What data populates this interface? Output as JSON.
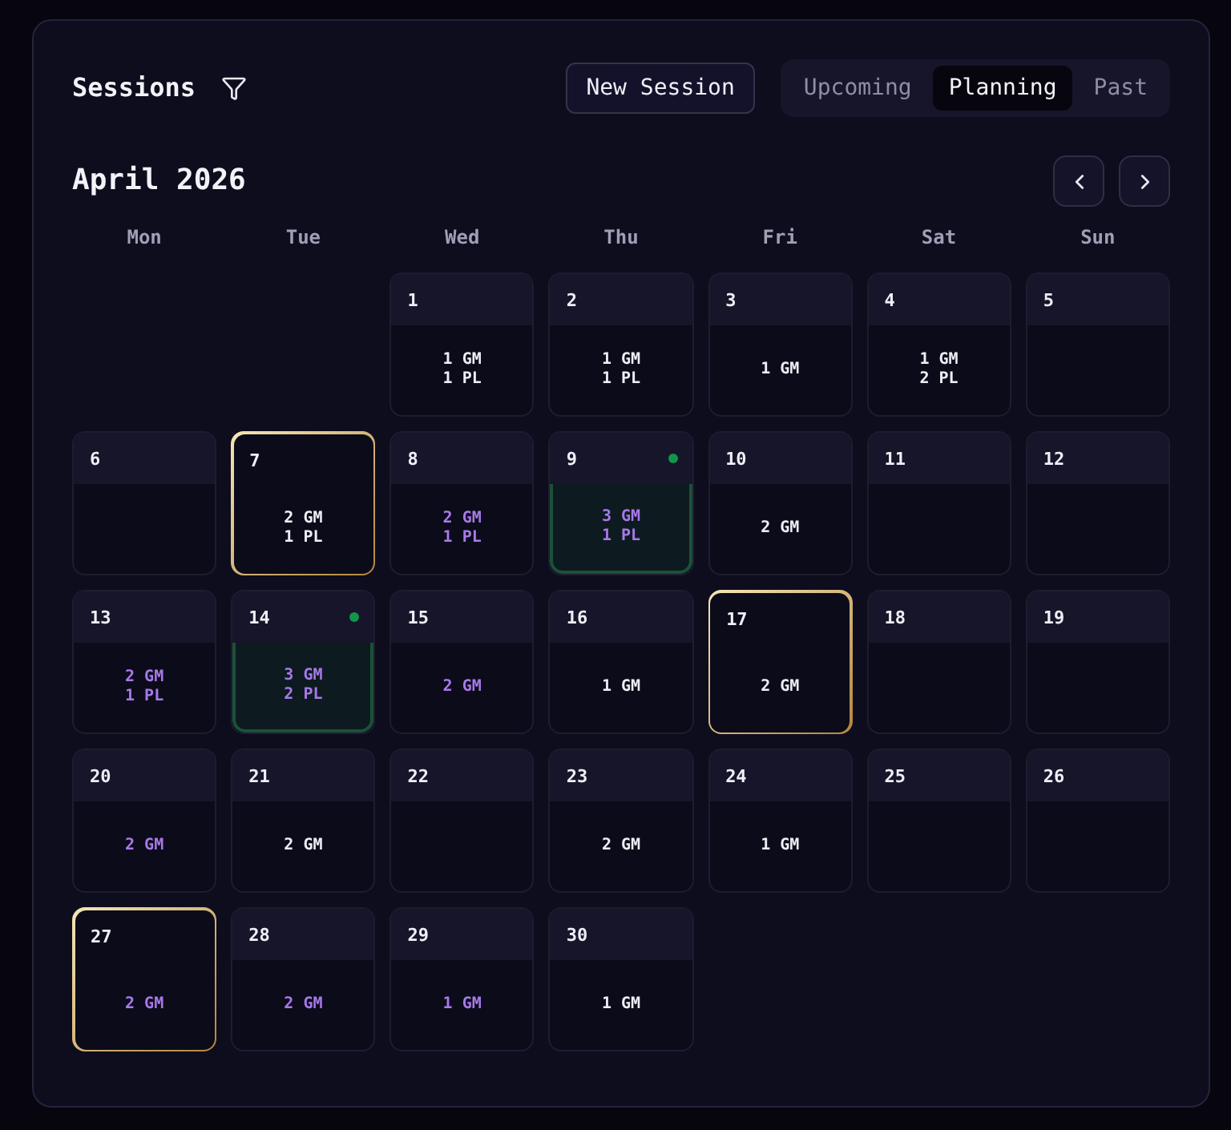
{
  "header": {
    "title": "Sessions",
    "new_session_button": "New Session",
    "tabs": [
      {
        "label": "Upcoming",
        "selected": false
      },
      {
        "label": "Planning",
        "selected": true
      },
      {
        "label": "Past",
        "selected": false
      }
    ]
  },
  "calendar": {
    "month": "April 2026",
    "weekdays": [
      "Mon",
      "Tue",
      "Wed",
      "Thu",
      "Fri",
      "Sat",
      "Sun"
    ],
    "weeks": [
      {
        "slots": [
          {
            "kind": "empty"
          },
          {
            "kind": "empty"
          },
          {
            "kind": "day",
            "day": "1",
            "lines": [
              "1 GM",
              "1 PL"
            ],
            "accent": false,
            "outlined": false,
            "active": false
          },
          {
            "kind": "day",
            "day": "2",
            "lines": [
              "1 GM",
              "1 PL"
            ],
            "accent": false,
            "outlined": false,
            "active": false
          },
          {
            "kind": "day",
            "day": "3",
            "lines": [
              "1 GM"
            ],
            "accent": false,
            "outlined": false,
            "active": false
          },
          {
            "kind": "day",
            "day": "4",
            "lines": [
              "1 GM",
              "2 PL"
            ],
            "accent": false,
            "outlined": false,
            "active": false
          },
          {
            "kind": "day",
            "day": "5",
            "outlined": false,
            "active": false
          }
        ]
      },
      {
        "slots": [
          {
            "kind": "day",
            "day": "6",
            "outlined": false,
            "active": false
          },
          {
            "kind": "day",
            "day": "7",
            "lines": [
              "2 GM",
              "1 PL"
            ],
            "accent": false,
            "outlined": true,
            "active": false
          },
          {
            "kind": "day",
            "day": "8",
            "lines": [
              "2 GM",
              "1 PL"
            ],
            "accent": true,
            "outlined": false,
            "active": false
          },
          {
            "kind": "day",
            "day": "9",
            "lines": [
              "3 GM",
              "1 PL"
            ],
            "accent": true,
            "outlined": false,
            "active": true
          },
          {
            "kind": "day",
            "day": "10",
            "lines": [
              "2 GM"
            ],
            "accent": false,
            "outlined": false,
            "active": false
          },
          {
            "kind": "day",
            "day": "11",
            "outlined": false,
            "active": false
          },
          {
            "kind": "day",
            "day": "12",
            "outlined": false,
            "active": false
          }
        ]
      },
      {
        "slots": [
          {
            "kind": "day",
            "day": "13",
            "lines": [
              "2 GM",
              "1 PL"
            ],
            "accent": true,
            "outlined": false,
            "active": false
          },
          {
            "kind": "day",
            "day": "14",
            "lines": [
              "3 GM",
              "2 PL"
            ],
            "accent": true,
            "outlined": false,
            "active": true
          },
          {
            "kind": "day",
            "day": "15",
            "lines": [
              "2 GM"
            ],
            "accent": true,
            "outlined": false,
            "active": false
          },
          {
            "kind": "day",
            "day": "16",
            "lines": [
              "1 GM"
            ],
            "accent": false,
            "outlined": false,
            "active": false
          },
          {
            "kind": "day",
            "day": "17",
            "lines": [
              "2 GM"
            ],
            "accent": false,
            "outlined": true,
            "active": false
          },
          {
            "kind": "day",
            "day": "18",
            "outlined": false,
            "active": false
          },
          {
            "kind": "day",
            "day": "19",
            "outlined": false,
            "active": false
          }
        ]
      },
      {
        "slots": [
          {
            "kind": "day",
            "day": "20",
            "lines": [
              "2 GM"
            ],
            "accent": true,
            "outlined": false,
            "active": false
          },
          {
            "kind": "day",
            "day": "21",
            "lines": [
              "2 GM"
            ],
            "accent": false,
            "outlined": false,
            "active": false
          },
          {
            "kind": "day",
            "day": "22",
            "outlined": false,
            "active": false
          },
          {
            "kind": "day",
            "day": "23",
            "lines": [
              "2 GM"
            ],
            "accent": false,
            "outlined": false,
            "active": false
          },
          {
            "kind": "day",
            "day": "24",
            "lines": [
              "1 GM"
            ],
            "accent": false,
            "outlined": false,
            "active": false
          },
          {
            "kind": "day",
            "day": "25",
            "outlined": false,
            "active": false
          },
          {
            "kind": "day",
            "day": "26",
            "outlined": false,
            "active": false
          }
        ]
      },
      {
        "slots": [
          {
            "kind": "day",
            "day": "27",
            "lines": [
              "2 GM"
            ],
            "accent": true,
            "outlined": true,
            "active": false
          },
          {
            "kind": "day",
            "day": "28",
            "lines": [
              "2 GM"
            ],
            "accent": true,
            "outlined": false,
            "active": false
          },
          {
            "kind": "day",
            "day": "29",
            "lines": [
              "1 GM"
            ],
            "accent": true,
            "outlined": false,
            "active": false
          },
          {
            "kind": "day",
            "day": "30",
            "lines": [
              "1 GM"
            ],
            "accent": false,
            "outlined": false,
            "active": false
          },
          {
            "kind": "empty"
          },
          {
            "kind": "empty"
          },
          {
            "kind": "empty"
          }
        ]
      }
    ]
  }
}
